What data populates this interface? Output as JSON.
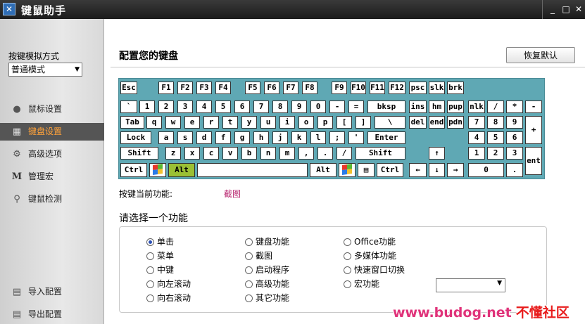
{
  "window": {
    "title": "键鼠助手",
    "min": "_",
    "max": "□",
    "close": "✕"
  },
  "sidebar": {
    "sim_label": "按键模拟方式",
    "sim_value": "普通模式",
    "items": [
      {
        "label": "鼠标设置",
        "icon": "mouse-icon"
      },
      {
        "label": "键盘设置",
        "icon": "keyboard-icon",
        "active": true
      },
      {
        "label": "高级选项",
        "icon": "gear-icon"
      },
      {
        "label": "管理宏",
        "icon": "macro-m-icon"
      },
      {
        "label": "键鼠检测",
        "icon": "magnifier-icon"
      },
      {
        "label": "导入配置",
        "icon": "import-icon"
      },
      {
        "label": "导出配置",
        "icon": "export-icon"
      }
    ]
  },
  "main": {
    "title": "配置您的键盘",
    "restore_label": "恢复默认",
    "current_fn_label": "按键当前功能:",
    "current_fn_value": "截图",
    "choose_label": "请选择一个功能",
    "options": {
      "col1": [
        "单击",
        "菜单",
        "中键",
        "向左滚动",
        "向右滚动"
      ],
      "col2": [
        "键盘功能",
        "截图",
        "启动程序",
        "高级功能",
        "其它功能"
      ],
      "col3": [
        "Office功能",
        "多媒体功能",
        "快速窗口切换",
        "宏功能"
      ]
    },
    "selected_option": "单击"
  },
  "keyboard": {
    "keys": [
      "Esc",
      "F1",
      "F2",
      "F3",
      "F4",
      "F5",
      "F6",
      "F7",
      "F8",
      "F9",
      "F10",
      "F11",
      "F12",
      "psc",
      "slk",
      "brk",
      "`",
      "1",
      "2",
      "3",
      "4",
      "5",
      "6",
      "7",
      "8",
      "9",
      "0",
      "-",
      "=",
      "bksp",
      "ins",
      "hm",
      "pup",
      "nlk",
      "/",
      "*",
      "-",
      "Tab",
      "q",
      "w",
      "e",
      "r",
      "t",
      "y",
      "u",
      "i",
      "o",
      "p",
      "[",
      "]",
      "\\",
      "del",
      "end",
      "pdn",
      "7",
      "8",
      "9",
      "+",
      "Lock",
      "a",
      "s",
      "d",
      "f",
      "g",
      "h",
      "j",
      "k",
      "l",
      ";",
      "'",
      "Enter",
      "4",
      "5",
      "6",
      "Shift",
      "z",
      "x",
      "c",
      "v",
      "b",
      "n",
      "m",
      ",",
      ".",
      "/",
      "Shift",
      "↑",
      "1",
      "2",
      "3",
      "ent",
      "Ctrl",
      "Alt",
      "Alt",
      "Ctrl",
      "←",
      "↓",
      "→",
      "0",
      "."
    ]
  },
  "watermark": {
    "site": "www.budog.net",
    "name": "不懂社区"
  },
  "colors": {
    "keyboard_bg": "#5fa8b4",
    "active_nav_text": "#ffa23a",
    "alt_highlight": "#9bc034",
    "fn_value": "#b8266f"
  }
}
